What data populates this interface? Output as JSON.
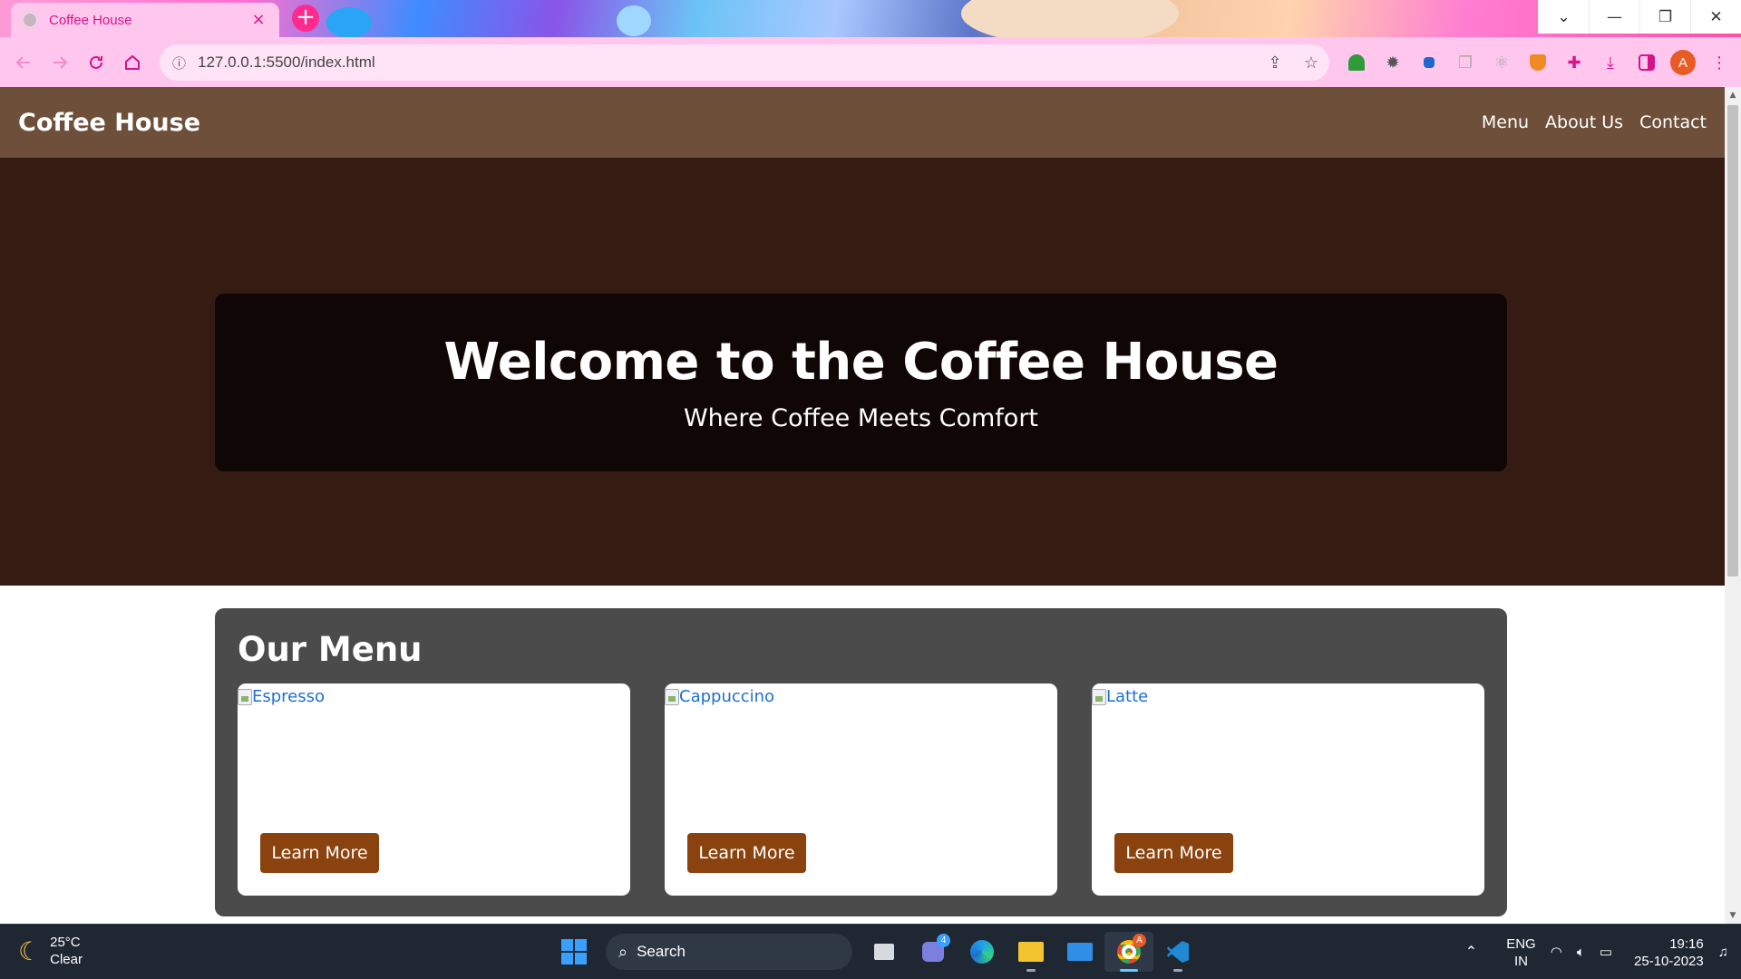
{
  "browser": {
    "tab_title": "Coffee House",
    "tab_close": "×",
    "new_tab": "+",
    "url": "127.0.0.1:5500/index.html",
    "window_controls": [
      "⌄",
      "—",
      "❐",
      "✕"
    ],
    "profile_initial": "A"
  },
  "page": {
    "brand": "Coffee House",
    "nav": [
      "Menu",
      "About Us",
      "Contact"
    ],
    "hero_title": "Welcome to the Coffee House",
    "hero_subtitle": "Where Coffee Meets Comfort",
    "menu_title": "Our Menu",
    "cards": [
      {
        "image_alt": "Espresso",
        "button": "Learn More"
      },
      {
        "image_alt": "Cappuccino",
        "button": "Learn More"
      },
      {
        "image_alt": "Latte",
        "button": "Learn More"
      }
    ]
  },
  "taskbar": {
    "weather_temp": "25°C",
    "weather_desc": "Clear",
    "search_label": "Search",
    "teams_badge": "4",
    "chrome_badge": "A",
    "lang_top": "ENG",
    "lang_bottom": "IN",
    "time": "19:16",
    "date": "25-10-2023"
  },
  "colors": {
    "header_bg": "#6e4f39",
    "hero_bg": "#351c12",
    "hero_box": "#0f0605",
    "menu_bg": "#4b4b4b",
    "button_bg": "#8a420f",
    "browser_accent": "#d6138a"
  }
}
